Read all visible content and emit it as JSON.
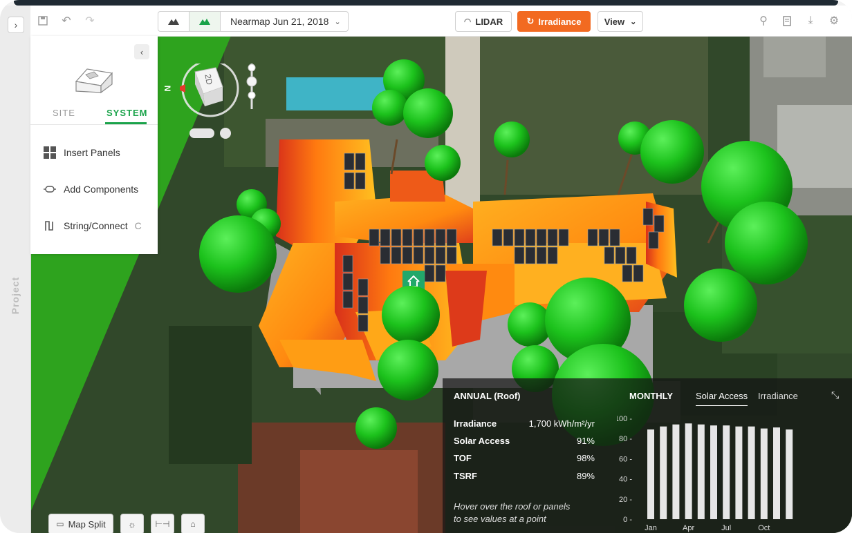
{
  "rail": {
    "expand_icon": "chevron-right-icon",
    "label": "Project"
  },
  "toolbar": {
    "imagery_label": "Nearmap Jun 21, 2018",
    "lidar_label": "LIDAR",
    "irradiance_label": "Irradiance",
    "view_label": "View"
  },
  "panel": {
    "tabs": [
      {
        "label": "SITE"
      },
      {
        "label": "SYSTEM"
      }
    ],
    "active_tab": "SYSTEM",
    "items": [
      {
        "label": "Insert Panels",
        "icon": "grid-icon"
      },
      {
        "label": "Add Components",
        "icon": "component-icon"
      },
      {
        "label": "String/Connect",
        "icon": "string-icon",
        "shortcut": "C"
      }
    ]
  },
  "compass": {
    "north_label": "N",
    "mode_label": "2D"
  },
  "info": {
    "annual_title": "ANNUAL (Roof)",
    "monthly_title": "MONTHLY",
    "tabs": [
      {
        "label": "Solar Access"
      },
      {
        "label": "Irradiance"
      }
    ],
    "metrics": [
      {
        "label": "Irradiance",
        "value": "1,700 kWh/m²/yr"
      },
      {
        "label": "Solar Access",
        "value": "91%"
      },
      {
        "label": "TOF",
        "value": "98%"
      },
      {
        "label": "TSRF",
        "value": "89%"
      }
    ],
    "hint_line1": "Hover over the roof or panels",
    "hint_line2": "to see values at a point",
    "y_ticks": [
      "100",
      "80",
      "60",
      "40",
      "20",
      "0"
    ],
    "month_labels": [
      "Jan",
      "Apr",
      "Jul",
      "Oct"
    ]
  },
  "chart_data": {
    "type": "bar",
    "categories": [
      "Jan",
      "Feb",
      "Mar",
      "Apr",
      "May",
      "Jun",
      "Jul",
      "Aug",
      "Sep",
      "Oct",
      "Nov",
      "Dec"
    ],
    "values": [
      89,
      92,
      94,
      95,
      94,
      93,
      93,
      92,
      92,
      90,
      91,
      89
    ],
    "ylim": [
      0,
      100
    ],
    "color": "#e6e6e6"
  },
  "bottom_toolbar": {
    "map_split_label": "Map Split"
  },
  "colors": {
    "accent_green": "#1aa34a",
    "irradiance_orange": "#f26a21"
  }
}
